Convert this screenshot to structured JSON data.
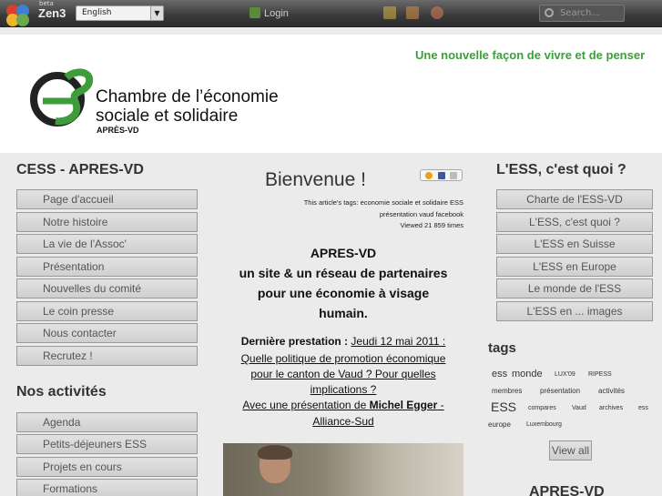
{
  "topbar": {
    "beta_label": "beta",
    "brand": "Zen3",
    "language": "English",
    "login_label": "Login",
    "search_placeholder": "Search..."
  },
  "banner": {
    "tagline": "Une nouvelle façon de vivre et de penser",
    "org_line1": "Chambre de l’économie",
    "org_line2": "sociale et solidaire",
    "org_sub": "APRÈS-VD",
    "colors": {
      "accent_green": "#3d9d3a",
      "logo_dark": "#222222"
    }
  },
  "left": {
    "title1": "CESS - APRES-VD",
    "menu1": [
      "Page d'accueil",
      "Notre histoire",
      "La vie de l'Assoc'",
      "Présentation",
      "Nouvelles du comité",
      "Le coin presse",
      "Nous contacter",
      "Recrutez !"
    ],
    "title2": "Nos activités",
    "menu2": [
      "Agenda",
      "Petits-déjeuners ESS",
      "Projets en cours",
      "Formations"
    ]
  },
  "center": {
    "title": "Bienvenue !",
    "tags_prefix": "This article's tags:",
    "tags_line1": "economie sociale et solidaire ESS",
    "tags_line2": "présentation vaud facebook",
    "views": "Viewed 21 859 times",
    "heading1": "APRES-VD",
    "heading2": "un site & un réseau de partenaires",
    "heading3": "pour une économie à visage",
    "heading4": "humain.",
    "last_label": "Dernière prestation : ",
    "last_date": "Jeudi 12 mai 2011 :",
    "link1": "Quelle politique de promotion économique",
    "link2": "pour le canton de Vaud ? Pour quelles",
    "link3": "implications ? ",
    "link4_prefix": "Avec une présentation de ",
    "link4_name": "Michel Egger",
    "link4_suffix": " -",
    "link5": "Alliance-Sud"
  },
  "right": {
    "title": "L'ESS, c'est quoi ?",
    "menu": [
      "Charte de l'ESS-VD",
      "L'ESS, c'est quoi ?",
      "L'ESS en Suisse",
      "L'ESS en Europe",
      "Le monde de l'ESS",
      "L'ESS en ... images"
    ],
    "tags_title": "tags",
    "tags": [
      "ess",
      "monde",
      "LUX'09",
      "RIPESS",
      "membres",
      "présentation",
      "activités",
      "ESS",
      "compares",
      "Vaud",
      "archives",
      "ess",
      "europe",
      "Luxembourg"
    ],
    "view_all": "View all",
    "bottom_title": "APRES-VD"
  }
}
